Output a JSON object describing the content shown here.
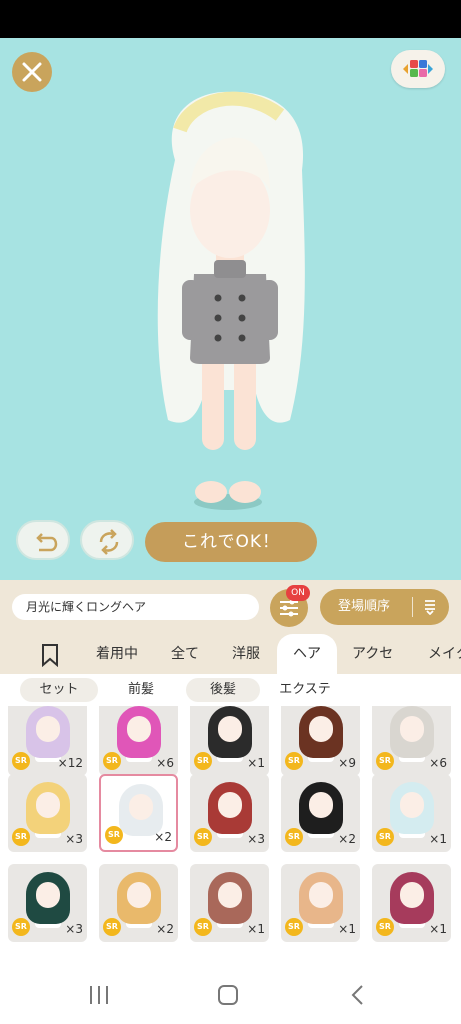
{
  "header": {
    "close_icon": "close-icon",
    "view_icon": "color-view-icon"
  },
  "actions": {
    "undo_icon": "undo-icon",
    "refresh_icon": "refresh-icon",
    "ok_label": "これでOK！"
  },
  "info": {
    "item_name": "月光に輝くロングヘア",
    "filter_badge": "ON",
    "sort_label": "登場順序"
  },
  "tabs": [
    {
      "label": "着用中"
    },
    {
      "label": "全て"
    },
    {
      "label": "洋服"
    },
    {
      "label": "ヘア"
    },
    {
      "label": "アクセ"
    },
    {
      "label": "メイク"
    }
  ],
  "subtabs": [
    {
      "label": "セット"
    },
    {
      "label": "前髪"
    },
    {
      "label": "後髪"
    },
    {
      "label": "エクステ"
    }
  ],
  "items": [
    {
      "rarity": "SR",
      "count": "×12",
      "color": "#d8c3e8"
    },
    {
      "rarity": "SR",
      "count": "×6",
      "color": "#e056b8"
    },
    {
      "rarity": "SR",
      "count": "×1",
      "color": "#2b2b2b"
    },
    {
      "rarity": "SR",
      "count": "×9",
      "color": "#6b3322"
    },
    {
      "rarity": "SR",
      "count": "×6",
      "color": "#d9d6d0"
    },
    {
      "rarity": "SR",
      "count": "×3",
      "color": "#f3d27a"
    },
    {
      "rarity": "SR",
      "count": "×2",
      "color": "#e7ecef",
      "selected": true
    },
    {
      "rarity": "SR",
      "count": "×3",
      "color": "#a93a36"
    },
    {
      "rarity": "SR",
      "count": "×2",
      "color": "#1e1e1e"
    },
    {
      "rarity": "SR",
      "count": "×1",
      "color": "#d4ecf0"
    },
    {
      "rarity": "SR",
      "count": "×3",
      "color": "#1f4a42"
    },
    {
      "rarity": "SR",
      "count": "×2",
      "color": "#e9b96b"
    },
    {
      "rarity": "SR",
      "count": "×1",
      "color": "#a9685a"
    },
    {
      "rarity": "SR",
      "count": "×1",
      "color": "#e8b68a"
    },
    {
      "rarity": "SR",
      "count": "×1",
      "color": "#a63b5c"
    }
  ],
  "nav": {
    "recent_icon": "recent-apps-icon",
    "home_icon": "home-icon",
    "back_icon": "back-icon"
  }
}
